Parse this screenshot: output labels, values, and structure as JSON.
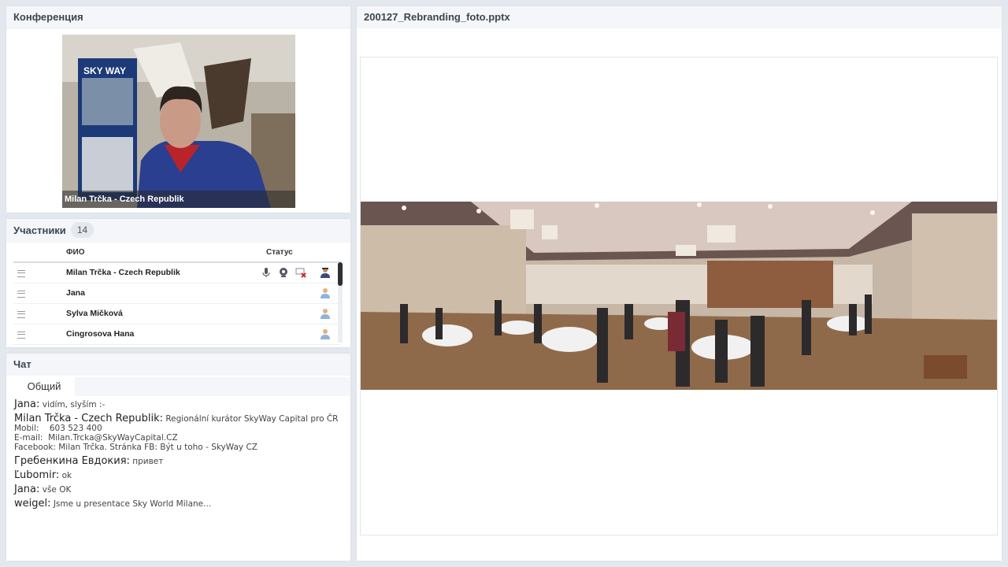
{
  "conference": {
    "title": "Конференция",
    "video_label": "Milan Trčka - Czech Republik"
  },
  "participants": {
    "title": "Участники",
    "count": "14",
    "col_name": "ФИО",
    "col_status": "Статус",
    "rows": [
      {
        "name": "Milan Trčka - Czech Republik",
        "status": [
          "mic-icon",
          "webcam-icon",
          "screen-off-icon",
          "presenter-icon"
        ]
      },
      {
        "name": "Jana",
        "status": [
          "user-icon"
        ]
      },
      {
        "name": "Sylva Mičková",
        "status": [
          "user-icon"
        ]
      },
      {
        "name": "Cingrosova Hana",
        "status": [
          "user-icon"
        ]
      }
    ]
  },
  "chat": {
    "title": "Чат",
    "tab": "Общий",
    "messages": [
      {
        "author": "Jana:",
        "text": "vidím, slyším :-"
      },
      {
        "author": "Milan Trčka - Czech Republik:",
        "text": "Regionální kurátor SkyWay Capital pro ČR\nMobil:    603 523 400\nE-mail:  Milan.Trcka@SkyWayCapital.CZ\nFacebook: Milan Trčka. Stránka FB: Být u toho - SkyWay CZ"
      },
      {
        "author": "Гребенкина Евдокия:",
        "text": "привет"
      },
      {
        "author": "Ľubomir:",
        "text": "ok"
      },
      {
        "author": "Jana:",
        "text": "vše OK"
      },
      {
        "author": "weigel:",
        "text": "Jsme u presentace Sky World Milane..."
      }
    ]
  },
  "presentation": {
    "title": "200127_Rebranding_foto.pptx"
  },
  "colors": {
    "background": "#e3e8ee",
    "panel_header": "#f4f6f9",
    "accent": "#2c2f33"
  }
}
